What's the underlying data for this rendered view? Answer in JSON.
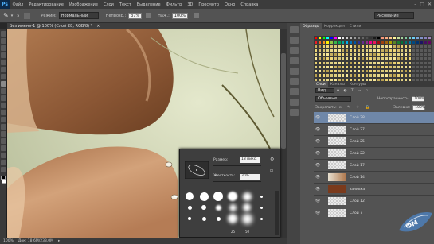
{
  "app": {
    "logo": "Ps"
  },
  "menu": [
    "Файл",
    "Редактирование",
    "Изображение",
    "Слои",
    "Текст",
    "Выделение",
    "Фильтр",
    "3D",
    "Просмотр",
    "Окно",
    "Справка"
  ],
  "options": {
    "brush_size": "5",
    "mode_label": "Режим:",
    "mode_value": "Нормальный",
    "opacity_label": "Непрозр.:",
    "opacity_value": "37%",
    "pressure_label": "Наж.:",
    "pressure_value": "100%",
    "workspace": "Рисование"
  },
  "document": {
    "tab_title": "Без имени-1 @ 100% (Слой 28, RGB/8) *"
  },
  "status": {
    "zoom": "100%",
    "doc_size": "Док: 18,6M/233,0M"
  },
  "swatches_panel": {
    "tabs": [
      "Образцы",
      "Коррекция",
      "Стили"
    ]
  },
  "layers_panel": {
    "tabs": [
      "Слои",
      "Каналы",
      "Контуры"
    ],
    "kind_filter": "Вид",
    "blend_mode": "Обычные",
    "opacity_label": "Непрозрачность:",
    "opacity_value": "100%",
    "lock_label": "Закрепить:",
    "fill_label": "Заливка:",
    "fill_value": "100%",
    "layers": [
      {
        "name": "Слой 28",
        "selected": true
      },
      {
        "name": "Слой 27",
        "selected": false
      },
      {
        "name": "Слой 25",
        "selected": false
      },
      {
        "name": "Слой 22",
        "selected": false
      },
      {
        "name": "Слой 17",
        "selected": false
      },
      {
        "name": "Слой 14",
        "selected": false
      },
      {
        "name": "заливка",
        "selected": false
      },
      {
        "name": "Слой 12",
        "selected": false
      },
      {
        "name": "Слой 7",
        "selected": false
      }
    ]
  },
  "brush_picker": {
    "size_label": "Размер:",
    "size_value": "18 пикс.",
    "hardness_label": "Жесткость:",
    "hardness_value": "30%",
    "brush_labels": [
      "25",
      "50"
    ]
  },
  "colors": {
    "accent": "#4a6fa5",
    "selected_layer": "#6f87a8"
  }
}
